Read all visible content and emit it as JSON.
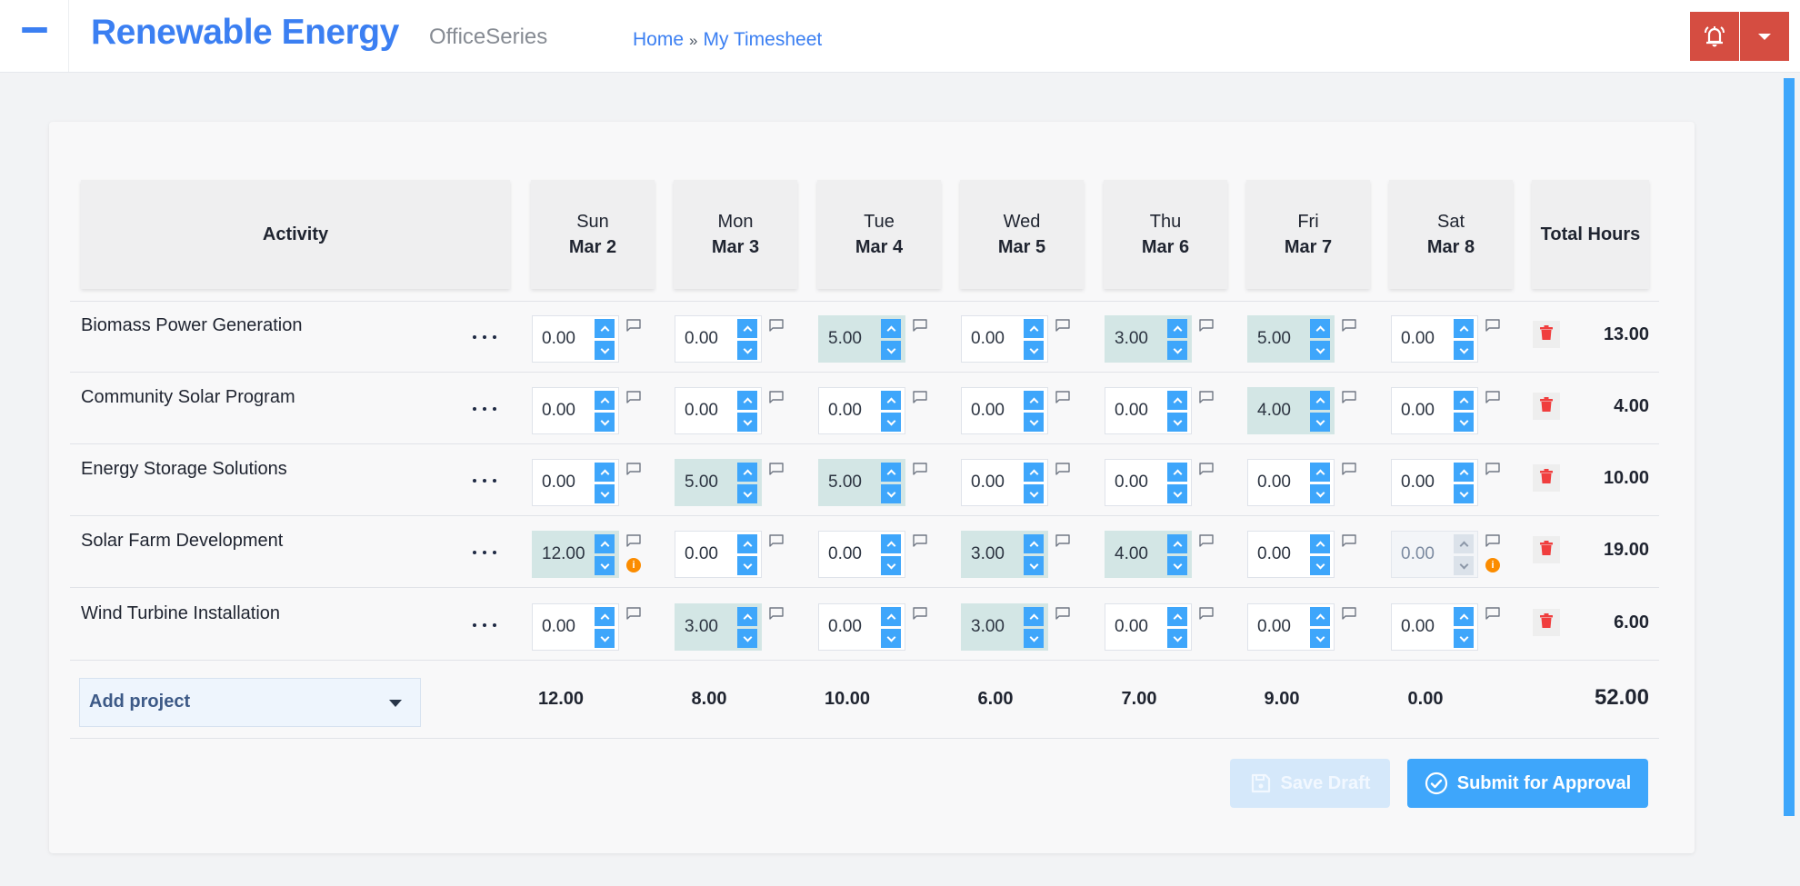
{
  "header": {
    "app_title": "Renewable Energy",
    "app_subtitle": "OfficeSeries",
    "breadcrumb": [
      {
        "label": "Home"
      },
      {
        "label": "My Timesheet"
      }
    ],
    "breadcrumb_separator": "»",
    "icons": {
      "menu": "hamburger-icon",
      "alert": "bell-icon",
      "alert_menu": "caret-down-icon"
    }
  },
  "colors": {
    "accent": "#3b7ff2",
    "primary_button": "#3ea6fb",
    "alert": "#d54d41",
    "filled_cell": "#d3e6e5",
    "delete": "#f03e3e",
    "warning": "#fb8c00"
  },
  "table": {
    "activity_header": "Activity",
    "total_header": "Total Hours",
    "days": [
      {
        "dow": "Sun",
        "date": "Mar 2"
      },
      {
        "dow": "Mon",
        "date": "Mar 3"
      },
      {
        "dow": "Tue",
        "date": "Mar 4"
      },
      {
        "dow": "Wed",
        "date": "Mar 5"
      },
      {
        "dow": "Thu",
        "date": "Mar 6"
      },
      {
        "dow": "Fri",
        "date": "Mar 7"
      },
      {
        "dow": "Sat",
        "date": "Mar 8"
      }
    ],
    "rows": [
      {
        "activity": "Biomass Power Generation",
        "hours": [
          "0.00",
          "0.00",
          "5.00",
          "0.00",
          "3.00",
          "5.00",
          "0.00"
        ],
        "filled": [
          false,
          false,
          true,
          false,
          true,
          true,
          false
        ],
        "disabled": [
          false,
          false,
          false,
          false,
          false,
          false,
          false
        ],
        "warnings": [
          false,
          false,
          false,
          false,
          false,
          false,
          false
        ],
        "total": "13.00"
      },
      {
        "activity": "Community Solar Program",
        "hours": [
          "0.00",
          "0.00",
          "0.00",
          "0.00",
          "0.00",
          "4.00",
          "0.00"
        ],
        "filled": [
          false,
          false,
          false,
          false,
          false,
          true,
          false
        ],
        "disabled": [
          false,
          false,
          false,
          false,
          false,
          false,
          false
        ],
        "warnings": [
          false,
          false,
          false,
          false,
          false,
          false,
          false
        ],
        "total": "4.00"
      },
      {
        "activity": "Energy Storage Solutions",
        "hours": [
          "0.00",
          "5.00",
          "5.00",
          "0.00",
          "0.00",
          "0.00",
          "0.00"
        ],
        "filled": [
          false,
          true,
          true,
          false,
          false,
          false,
          false
        ],
        "disabled": [
          false,
          false,
          false,
          false,
          false,
          false,
          false
        ],
        "warnings": [
          false,
          false,
          false,
          false,
          false,
          false,
          false
        ],
        "total": "10.00"
      },
      {
        "activity": "Solar Farm Development",
        "hours": [
          "12.00",
          "0.00",
          "0.00",
          "3.00",
          "4.00",
          "0.00",
          "0.00"
        ],
        "filled": [
          true,
          false,
          false,
          true,
          true,
          false,
          false
        ],
        "disabled": [
          false,
          false,
          false,
          false,
          false,
          false,
          true
        ],
        "warnings": [
          true,
          false,
          false,
          false,
          false,
          false,
          true
        ],
        "total": "19.00"
      },
      {
        "activity": "Wind Turbine Installation",
        "hours": [
          "0.00",
          "3.00",
          "0.00",
          "3.00",
          "0.00",
          "0.00",
          "0.00"
        ],
        "filled": [
          false,
          true,
          false,
          true,
          false,
          false,
          false
        ],
        "disabled": [
          false,
          false,
          false,
          false,
          false,
          false,
          false
        ],
        "warnings": [
          false,
          false,
          false,
          false,
          false,
          false,
          false
        ],
        "total": "6.00"
      }
    ],
    "day_totals": [
      "12.00",
      "8.00",
      "10.00",
      "6.00",
      "7.00",
      "9.00",
      "0.00"
    ],
    "grand_total": "52.00",
    "add_project_label": "Add project",
    "row_icons": {
      "more": "ellipsis-icon",
      "comment": "comment-icon",
      "warning": "info-icon",
      "delete": "trash-icon"
    },
    "warning_glyph": "i"
  },
  "actions": {
    "save_draft_label": "Save Draft",
    "submit_label": "Submit for Approval",
    "save_draft_enabled": false
  }
}
